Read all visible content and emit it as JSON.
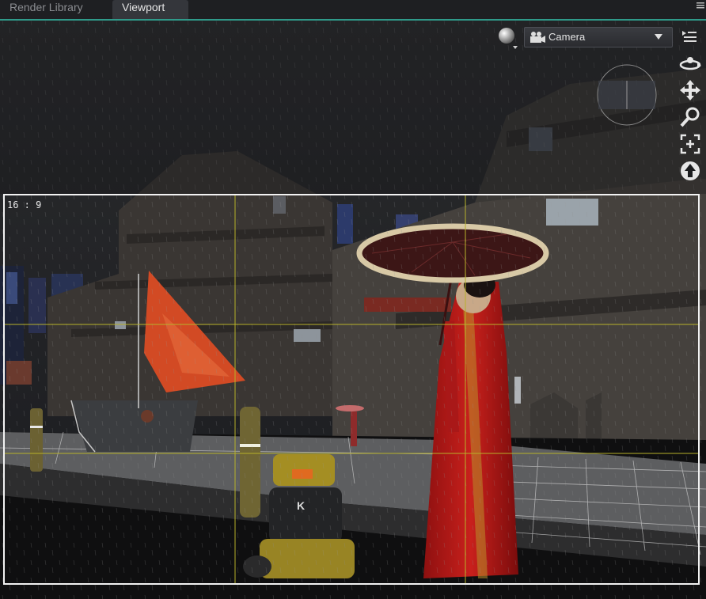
{
  "tabs": [
    {
      "label": "Render Library",
      "active": false
    },
    {
      "label": "Viewport",
      "active": true
    }
  ],
  "viewport": {
    "camera": {
      "selected": "Camera"
    },
    "aspect_ratio": "16 : 9"
  },
  "colors": {
    "accent": "#2f9a8a",
    "frame": "#f2f2f2",
    "guides": "#b7b12a",
    "tab_active_bg": "#34363b"
  },
  "icons": {
    "camera": "camera-icon",
    "render_sphere": "render-sphere-icon",
    "menu": "panel-menu-icon",
    "orbit": "orbit-icon",
    "pan": "pan-icon",
    "zoom": "zoom-icon",
    "frame": "frame-icon",
    "reset": "reset-icon"
  }
}
